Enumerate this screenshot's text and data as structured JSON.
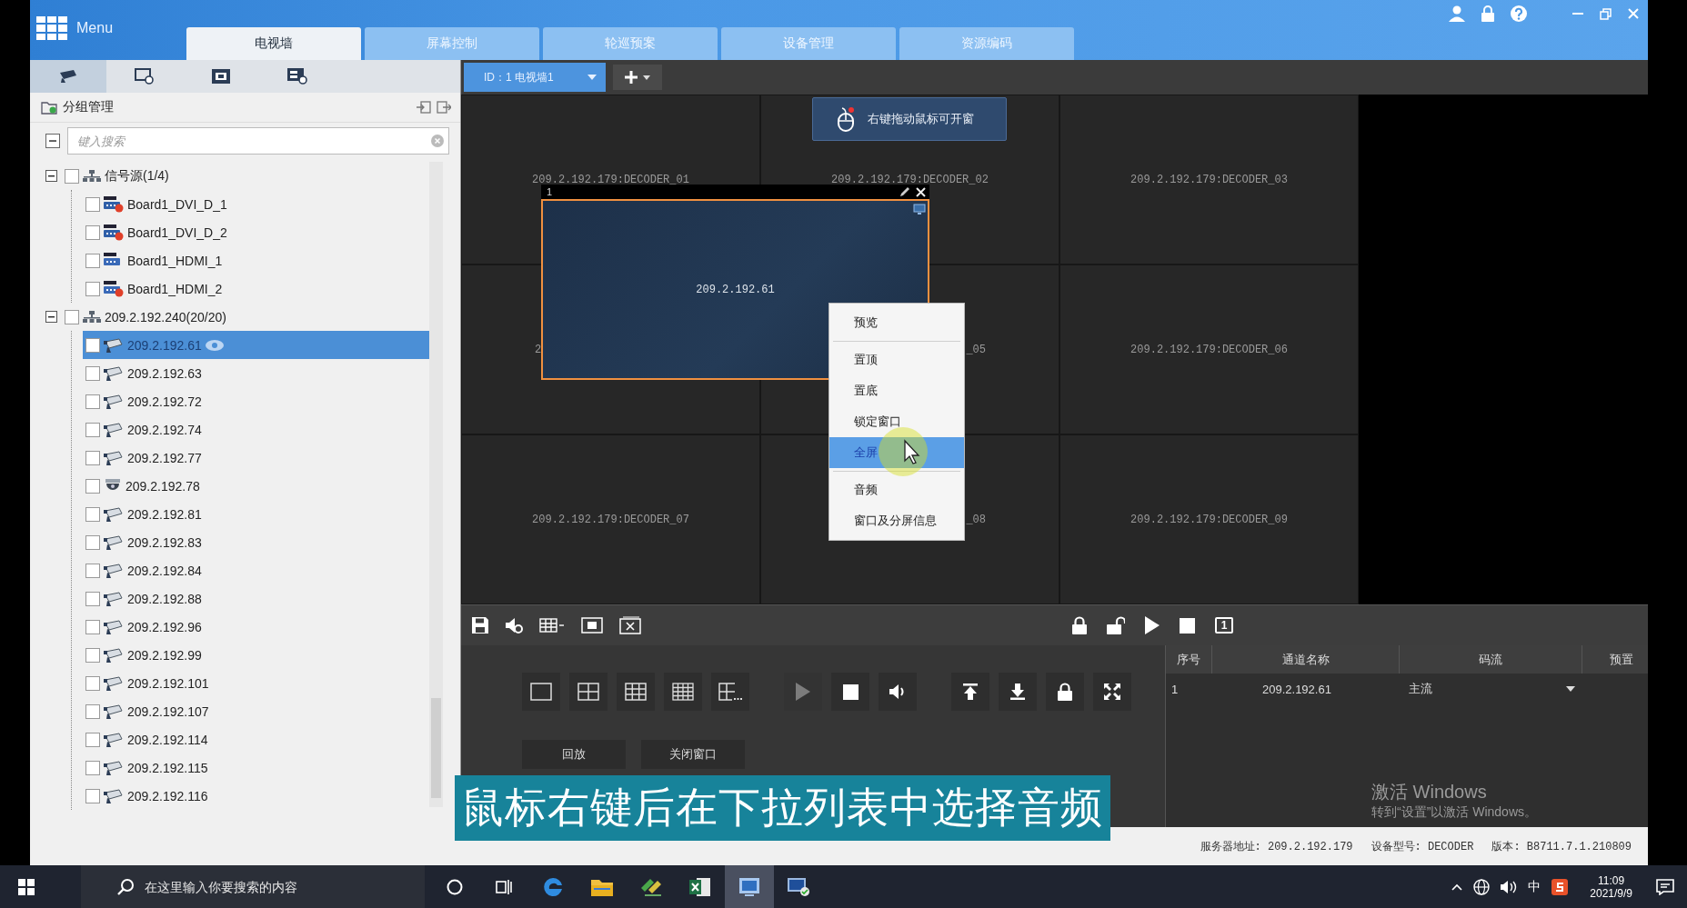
{
  "header": {
    "menu_label": "Menu",
    "tabs": [
      {
        "label": "电视墙",
        "selected": true
      },
      {
        "label": "屏幕控制",
        "selected": false
      },
      {
        "label": "轮巡预案",
        "selected": false
      },
      {
        "label": "设备管理",
        "selected": false
      },
      {
        "label": "资源编码",
        "selected": false
      }
    ]
  },
  "left_panel": {
    "icon_tabs": [
      {
        "kind": "camera",
        "selected": true
      },
      {
        "kind": "monitor-search",
        "selected": false
      },
      {
        "kind": "screen",
        "selected": false
      },
      {
        "kind": "screen-search",
        "selected": false
      }
    ],
    "title": "分组管理",
    "search": {
      "placeholder": "键入搜索"
    },
    "tree": [
      {
        "kind": "group",
        "label": "信号源(1/4)",
        "expanded": true,
        "checked": false,
        "children": [
          {
            "kind": "dvi",
            "label": "Board1_DVI_D_1",
            "checked": false,
            "selected": false,
            "offline": true
          },
          {
            "kind": "dvi",
            "label": "Board1_DVI_D_2",
            "checked": false,
            "selected": false,
            "offline": true
          },
          {
            "kind": "hdmi",
            "label": "Board1_HDMI_1",
            "checked": false,
            "selected": false,
            "offline": false
          },
          {
            "kind": "hdmi",
            "label": "Board1_HDMI_2",
            "checked": false,
            "selected": false,
            "offline": true
          }
        ]
      },
      {
        "kind": "group",
        "label": "209.2.192.240(20/20)",
        "expanded": true,
        "checked": false,
        "children": [
          {
            "kind": "camera",
            "label": "209.2.192.61",
            "checked": false,
            "selected": true,
            "offline": false
          },
          {
            "kind": "camera",
            "label": "209.2.192.63",
            "checked": false,
            "selected": false,
            "offline": false
          },
          {
            "kind": "camera",
            "label": "209.2.192.72",
            "checked": false,
            "selected": false,
            "offline": false
          },
          {
            "kind": "camera",
            "label": "209.2.192.74",
            "checked": false,
            "selected": false,
            "offline": false
          },
          {
            "kind": "camera",
            "label": "209.2.192.77",
            "checked": false,
            "selected": false,
            "offline": false
          },
          {
            "kind": "dome",
            "label": "209.2.192.78",
            "checked": false,
            "selected": false,
            "offline": false
          },
          {
            "kind": "camera",
            "label": "209.2.192.81",
            "checked": false,
            "selected": false,
            "offline": false
          },
          {
            "kind": "camera",
            "label": "209.2.192.83",
            "checked": false,
            "selected": false,
            "offline": false
          },
          {
            "kind": "camera",
            "label": "209.2.192.84",
            "checked": false,
            "selected": false,
            "offline": false
          },
          {
            "kind": "camera",
            "label": "209.2.192.88",
            "checked": false,
            "selected": false,
            "offline": false
          },
          {
            "kind": "camera",
            "label": "209.2.192.96",
            "checked": false,
            "selected": false,
            "offline": false
          },
          {
            "kind": "camera",
            "label": "209.2.192.99",
            "checked": false,
            "selected": false,
            "offline": false
          },
          {
            "kind": "camera",
            "label": "209.2.192.101",
            "checked": false,
            "selected": false,
            "offline": false
          },
          {
            "kind": "camera",
            "label": "209.2.192.107",
            "checked": false,
            "selected": false,
            "offline": false
          },
          {
            "kind": "camera",
            "label": "209.2.192.114",
            "checked": false,
            "selected": false,
            "offline": false
          },
          {
            "kind": "camera",
            "label": "209.2.192.115",
            "checked": false,
            "selected": false,
            "offline": false
          },
          {
            "kind": "camera",
            "label": "209.2.192.116",
            "checked": false,
            "selected": false,
            "offline": false
          }
        ]
      }
    ]
  },
  "wall": {
    "tab": {
      "label": "ID：1 电视墙1"
    },
    "tip": "右键拖动鼠标可开窗",
    "cells": [
      {
        "label": "209.2.192.179:DECODER_01",
        "kind": "full"
      },
      {
        "label": "209.2.192.179:DECODER_02",
        "kind": "full"
      },
      {
        "label": "209.2.192.179:DECODER_03",
        "kind": "full"
      },
      {
        "label": "2",
        "kind": "head"
      },
      {
        "label": "_05",
        "kind": "tail"
      },
      {
        "label": "209.2.192.179:DECODER_06",
        "kind": "full"
      },
      {
        "label": "209.2.192.179:DECODER_07",
        "kind": "full"
      },
      {
        "label": "_08",
        "kind": "tail"
      },
      {
        "label": "209.2.192.179:DECODER_09",
        "kind": "full"
      }
    ],
    "window": {
      "number": "1",
      "label": "209.2.192.61"
    },
    "context_menu": {
      "groups": [
        [
          {
            "label": "预览",
            "selected": false
          }
        ],
        [
          {
            "label": "置顶",
            "selected": false
          },
          {
            "label": "置底",
            "selected": false
          },
          {
            "label": "锁定窗口",
            "selected": false
          },
          {
            "label": "全屏",
            "selected": true
          }
        ],
        [
          {
            "label": "音频",
            "selected": false
          },
          {
            "label": "窗口及分屏信息",
            "selected": false
          }
        ]
      ]
    }
  },
  "toolbar": {
    "left": [
      {
        "kind": "save"
      },
      {
        "kind": "audio-settings"
      },
      {
        "kind": "grid-menu"
      },
      {
        "kind": "fit-window"
      },
      {
        "kind": "close-window"
      }
    ],
    "right": [
      {
        "kind": "lock"
      },
      {
        "kind": "unlock"
      },
      {
        "kind": "play"
      },
      {
        "kind": "stop"
      }
    ],
    "page_label": "1"
  },
  "controls": {
    "layouts": [
      {
        "kind": "single"
      },
      {
        "kind": "quad"
      },
      {
        "kind": "nine"
      },
      {
        "kind": "sixteen"
      },
      {
        "kind": "custom"
      }
    ],
    "playback": [
      {
        "kind": "play",
        "disabled": true
      },
      {
        "kind": "stop",
        "disabled": false
      },
      {
        "kind": "volume",
        "disabled": false
      }
    ],
    "window_actions": [
      {
        "kind": "top"
      },
      {
        "kind": "bottom"
      },
      {
        "kind": "lock"
      },
      {
        "kind": "fullscreen"
      }
    ],
    "buttons": [
      "回放",
      "关闭窗口"
    ]
  },
  "table": {
    "columns": [
      "序号",
      "通道名称",
      "码流",
      "预置"
    ],
    "rows": [
      {
        "cells": [
          "1",
          "209.2.192.61",
          "主流"
        ]
      }
    ]
  },
  "caption": "鼠标右键后在下拉列表中选择音频",
  "activation": {
    "title": "激活 Windows",
    "hint": "转到“设置”以激活 Windows。"
  },
  "status_bar": [
    "服务器地址: 209.2.192.179",
    "设备型号: DECODER",
    "版本: B8711.7.1.210809"
  ],
  "taskbar": {
    "search_placeholder": "在这里输入你要搜索的内容",
    "apps": [
      {
        "kind": "edge",
        "selected": false
      },
      {
        "kind": "folder",
        "selected": false
      },
      {
        "kind": "tool",
        "selected": false
      },
      {
        "kind": "excel",
        "selected": false
      },
      {
        "kind": "wall-app",
        "selected": true
      },
      {
        "kind": "client",
        "selected": false
      }
    ],
    "ime": "中",
    "time": "11:09",
    "date": "2021/9/9"
  }
}
